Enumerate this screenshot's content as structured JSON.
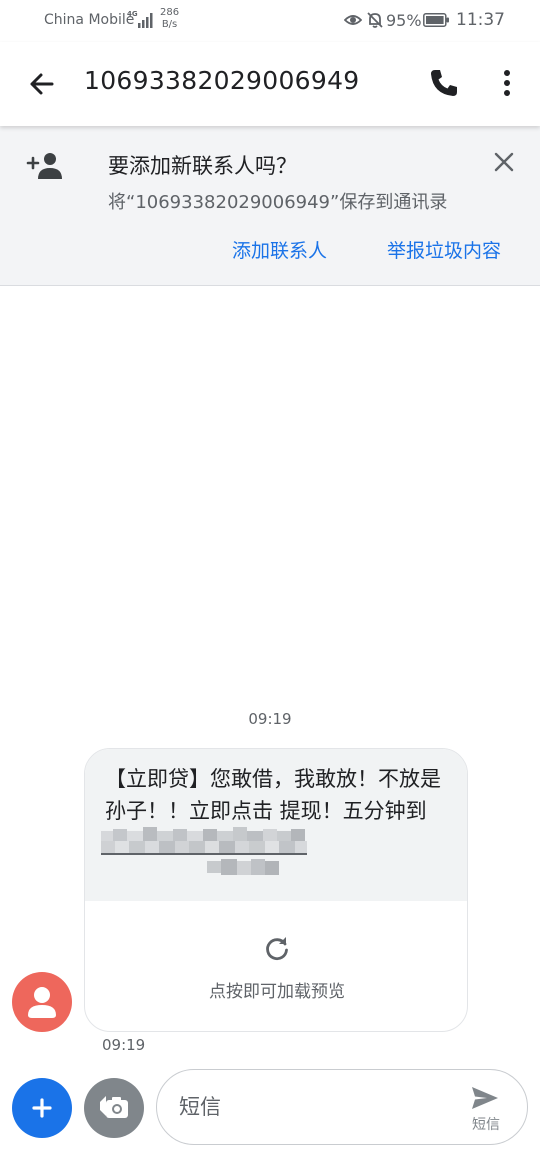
{
  "status_bar": {
    "carrier": "China Mobile",
    "network": "4G",
    "speed_value": "286",
    "speed_unit": "B/s",
    "battery": "95%",
    "time": "11:37"
  },
  "app_bar": {
    "title": "10693382029006949"
  },
  "banner": {
    "title": "要添加新联系人吗？",
    "subtitle": "将“10693382029006949”保存到通讯录",
    "add_label": "添加联系人",
    "report_label": "举报垃圾内容"
  },
  "conversation": {
    "timestamp": "09:19",
    "message_text": "【立即贷】您敢借，我敢放！不放是孙子！！立即点击                              提现！五分钟到账！退订T",
    "preview_label": "点按即可加载预览",
    "message_time": "09:19"
  },
  "compose": {
    "placeholder": "短信",
    "send_label": "短信"
  },
  "colors": {
    "accent": "#1a73e8",
    "avatar": "#ee675c",
    "banner_bg": "#f3f4f6",
    "bubble_bg": "#f1f3f4"
  }
}
